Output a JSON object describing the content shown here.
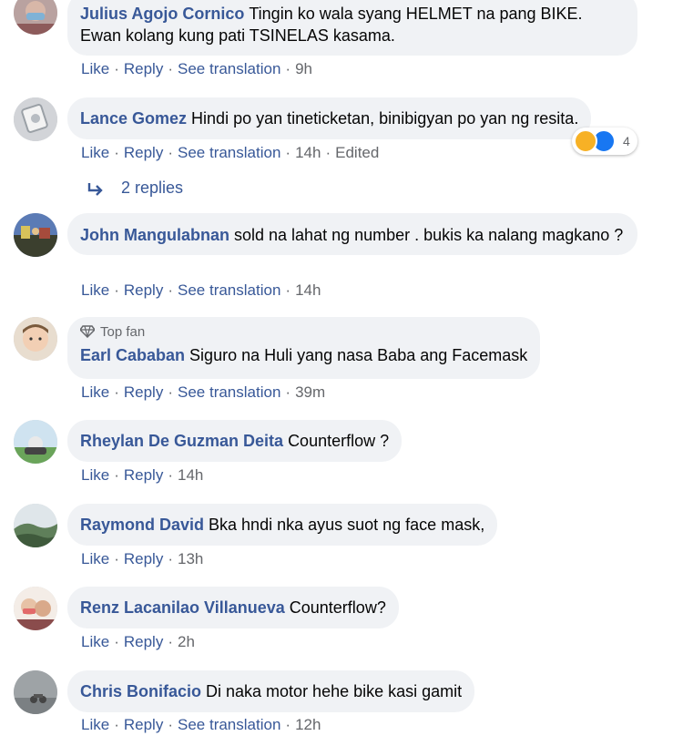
{
  "labels": {
    "like": "Like",
    "reply": "Reply",
    "see_translation": "See translation",
    "edited": "Edited",
    "top_fan": "Top fan"
  },
  "comments": [
    {
      "author": "Julius Agojo Cornico",
      "text": "Tingin ko wala syang HELMET na pang BIKE. Ewan kolang kung pati TSINELAS kasama.",
      "time": "9h"
    },
    {
      "author": "Lance Gomez",
      "text": "Hindi po yan tineticketan, binibigyan po yan ng resita.",
      "time": "14h",
      "reaction_count": "4",
      "replies": "2 replies"
    },
    {
      "author": "John Mangulabnan",
      "text": "sold na lahat ng number . bukis ka nalang magkano ?",
      "time": "14h"
    },
    {
      "author": "Earl Cababan",
      "text": "Siguro na Huli yang nasa Baba ang Facemask",
      "time": "39m"
    },
    {
      "author": "Rheylan De Guzman Deita",
      "text": "Counterflow ?",
      "time": "14h"
    },
    {
      "author": "Raymond David",
      "text": "Bka hndi nka ayus suot ng face mask,",
      "time": "13h"
    },
    {
      "author": "Renz Lacanilao Villanueva",
      "text": "Counterflow?",
      "time": "2h"
    },
    {
      "author": "Chris Bonifacio",
      "text": "Di naka motor hehe bike kasi gamit",
      "time": "12h"
    }
  ],
  "colors": {
    "author": "#385898",
    "bubble": "#f0f2f5",
    "meta": "#65676b",
    "haha": "#f7b125",
    "like": "#1877f2"
  },
  "icons": {
    "reply_arrow": "reply-arrow-icon",
    "diamond": "diamond-icon",
    "haha": "haha-reaction-icon",
    "like": "like-reaction-icon"
  }
}
